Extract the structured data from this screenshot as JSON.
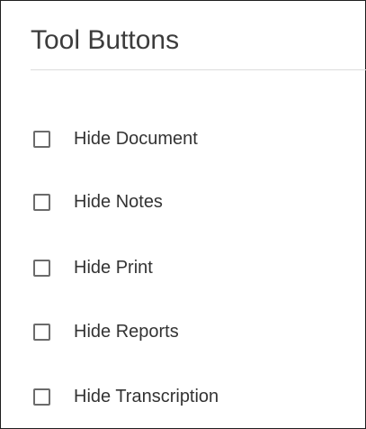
{
  "section": {
    "title": "Tool Buttons"
  },
  "options": [
    {
      "label": "Hide Document",
      "checked": false
    },
    {
      "label": "Hide Notes",
      "checked": false
    },
    {
      "label": "Hide Print",
      "checked": false
    },
    {
      "label": "Hide Reports",
      "checked": false
    },
    {
      "label": "Hide Transcription",
      "checked": false
    }
  ],
  "colors": {
    "text": "#333333",
    "title": "#3c3c3c",
    "checkbox_border": "#6b6b6b",
    "rule": "#dcdcdc"
  }
}
